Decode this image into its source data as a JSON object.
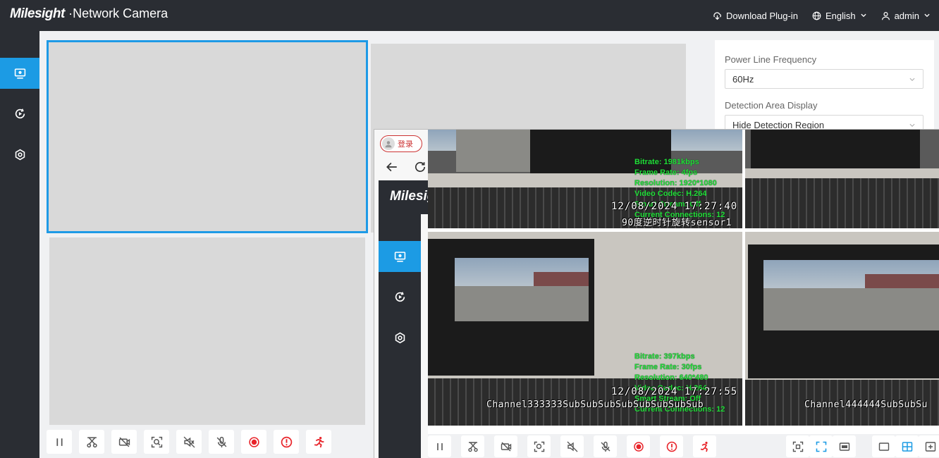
{
  "header": {
    "logo_text": "Milesight",
    "product_title": "·Network Camera",
    "download_plugin": "Download Plug-in",
    "language": "English",
    "user": "admin"
  },
  "sidebar": {
    "items": [
      {
        "icon": "live-view-icon",
        "active": true
      },
      {
        "icon": "playback-icon",
        "active": false
      },
      {
        "icon": "settings-icon",
        "active": false
      }
    ]
  },
  "settings_panel": {
    "power_line_label": "Power Line Frequency",
    "power_line_value": "60Hz",
    "detection_area_label": "Detection Area Display",
    "detection_area_value": "Hide Detection Region"
  },
  "overlay": {
    "login_label": "登录",
    "logo_text": "Milesight",
    "camera1": {
      "bitrate": "Bitrate: 1981kbps",
      "frame_rate": "Frame Rate: 4fps",
      "resolution": "Resolution: 1920*1080",
      "video_codec": "Video Codec: H.264",
      "smart_stream": "Smart Stream: Off",
      "connections": "Current Connections: 12",
      "timestamp": "12/08/2024 17:27:40",
      "channel": "90度逆时针旋转sensor1"
    },
    "camera3": {
      "bitrate": "Bitrate: 397kbps",
      "frame_rate": "Frame Rate: 30fps",
      "resolution": "Resolution: 640*480",
      "video_codec": "Video Codec: H.264",
      "smart_stream": "Smart Stream: Off",
      "connections": "Current Connections: 12",
      "timestamp": "12/08/2024 17:27:55",
      "channel": "Channel333333SubSubSubSubSubSubSubSub"
    },
    "camera4": {
      "channel": "Channel444444SubSubSu"
    }
  },
  "colors": {
    "accent": "#1c9be4",
    "header_bg": "#2a2d33",
    "record_red": "#e8242a",
    "osd_green": "#22e03a"
  }
}
